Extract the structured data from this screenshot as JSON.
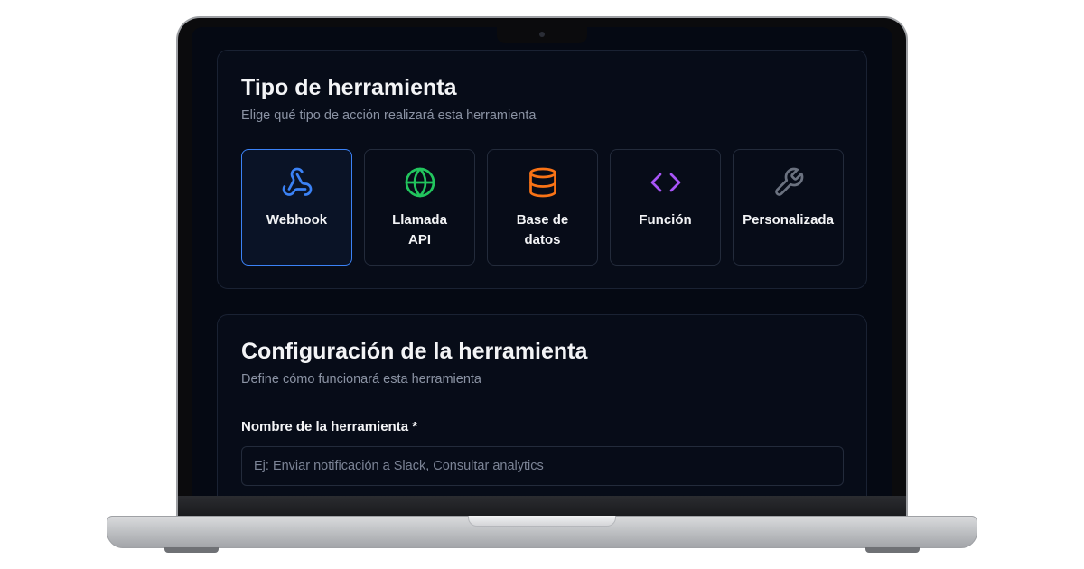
{
  "tool_type": {
    "title": "Tipo de herramienta",
    "subtitle": "Elige qué tipo de acción realizará esta herramienta",
    "options": [
      {
        "label": "Webhook",
        "icon": "webhook-icon",
        "color": "#3b82f6",
        "selected": true
      },
      {
        "label": "Llamada API",
        "icon": "globe-icon",
        "color": "#22c55e",
        "selected": false
      },
      {
        "label": "Base de datos",
        "icon": "database-icon",
        "color": "#f97316",
        "selected": false
      },
      {
        "label": "Función",
        "icon": "code-icon",
        "color": "#a855f7",
        "selected": false
      },
      {
        "label": "Personalizada",
        "icon": "wrench-icon",
        "color": "#6b7280",
        "selected": false
      }
    ]
  },
  "config": {
    "title": "Configuración de la herramienta",
    "subtitle": "Define cómo funcionará esta herramienta",
    "name_label": "Nombre de la herramienta *",
    "name_value": "",
    "name_placeholder": "Ej: Enviar notificación a Slack, Consultar analytics"
  }
}
